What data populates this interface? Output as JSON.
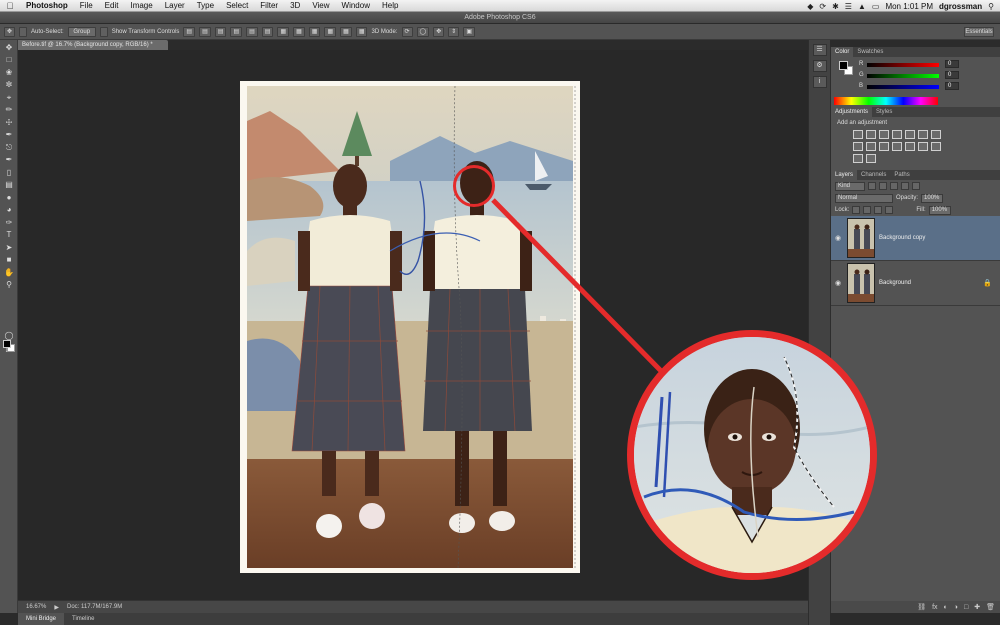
{
  "menubar": {
    "app_name": "Photoshop",
    "items": [
      "File",
      "Edit",
      "Image",
      "Layer",
      "Type",
      "Select",
      "Filter",
      "3D",
      "View",
      "Window",
      "Help"
    ],
    "clock": "Mon 1:01 PM",
    "user": "dgrossman"
  },
  "window": {
    "title": "Adobe Photoshop CS6"
  },
  "options": {
    "auto_select_label": "Auto-Select:",
    "auto_select_value": "Group",
    "transform_label": "Show Transform Controls",
    "mode3d_label": "3D Mode:",
    "workspace": "Essentials"
  },
  "document": {
    "tab_label": "Before.tif @ 16.7% (Background copy, RGB/16) *",
    "zoom": "16.67%",
    "doc_info": "Doc: 117.7M/167.9M"
  },
  "bottom_tabs": [
    "Mini Bridge",
    "Timeline"
  ],
  "panels": {
    "color_tabs": [
      "Color",
      "Swatches"
    ],
    "color_channels": [
      {
        "ch": "R",
        "value": "0"
      },
      {
        "ch": "G",
        "value": "0"
      },
      {
        "ch": "B",
        "value": "0"
      }
    ],
    "adj_tabs": [
      "Adjustments",
      "Styles"
    ],
    "adj_title": "Add an adjustment",
    "layers_tabs": [
      "Layers",
      "Channels",
      "Paths"
    ],
    "kind_label": "Kind",
    "blend_mode": "Normal",
    "opacity_label": "Opacity:",
    "opacity_value": "100%",
    "lock_label": "Lock:",
    "fill_label": "Fill:",
    "fill_value": "100%",
    "layers": [
      {
        "name": "Background copy",
        "active": true
      },
      {
        "name": "Background",
        "active": false
      }
    ]
  },
  "colors": {
    "accent_red": "#e42b2b",
    "selected_layer": "#5a6f88",
    "panel_bg": "#535353",
    "canvas_bg": "#282828"
  }
}
